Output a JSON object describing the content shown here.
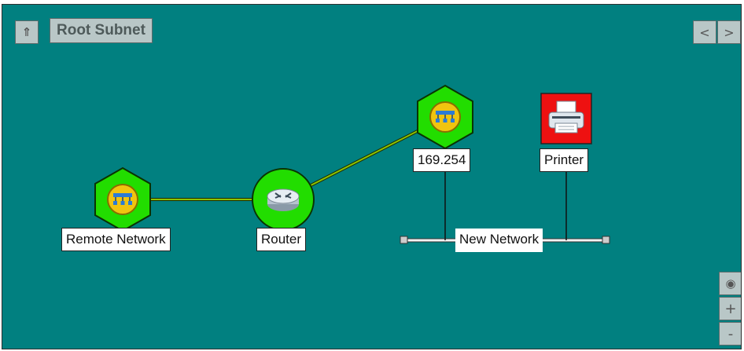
{
  "toolbar": {
    "up_symbol": "⇑",
    "title": "Root Subnet",
    "prev_symbol": "<",
    "next_symbol": ">"
  },
  "zoom": {
    "center_symbol": "◉",
    "zoom_in_symbol": "+",
    "zoom_out_symbol": "-"
  },
  "nodes": {
    "remote_network": {
      "label": "Remote Network",
      "icon": "network-hub-icon"
    },
    "router": {
      "label": "Router",
      "icon": "router-icon"
    },
    "subnet": {
      "label": "169.254",
      "icon": "network-hub-icon"
    },
    "printer": {
      "label": "Printer",
      "icon": "printer-icon"
    },
    "new_network": {
      "label": "New Network"
    }
  },
  "colors": {
    "background": "#018080",
    "node_ok": "#22dd00",
    "node_alert": "#ee1111",
    "link": "#6fa700"
  }
}
